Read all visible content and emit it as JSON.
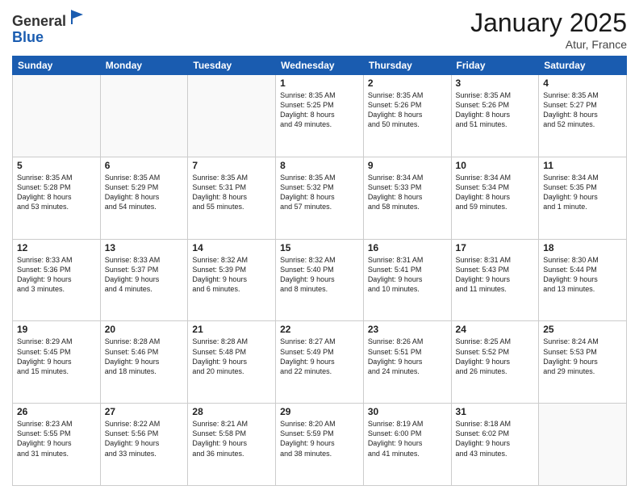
{
  "logo": {
    "general": "General",
    "blue": "Blue"
  },
  "title": "January 2025",
  "location": "Atur, France",
  "days": [
    "Sunday",
    "Monday",
    "Tuesday",
    "Wednesday",
    "Thursday",
    "Friday",
    "Saturday"
  ],
  "weeks": [
    [
      {
        "day": "",
        "content": ""
      },
      {
        "day": "",
        "content": ""
      },
      {
        "day": "",
        "content": ""
      },
      {
        "day": "1",
        "content": "Sunrise: 8:35 AM\nSunset: 5:25 PM\nDaylight: 8 hours\nand 49 minutes."
      },
      {
        "day": "2",
        "content": "Sunrise: 8:35 AM\nSunset: 5:26 PM\nDaylight: 8 hours\nand 50 minutes."
      },
      {
        "day": "3",
        "content": "Sunrise: 8:35 AM\nSunset: 5:26 PM\nDaylight: 8 hours\nand 51 minutes."
      },
      {
        "day": "4",
        "content": "Sunrise: 8:35 AM\nSunset: 5:27 PM\nDaylight: 8 hours\nand 52 minutes."
      }
    ],
    [
      {
        "day": "5",
        "content": "Sunrise: 8:35 AM\nSunset: 5:28 PM\nDaylight: 8 hours\nand 53 minutes."
      },
      {
        "day": "6",
        "content": "Sunrise: 8:35 AM\nSunset: 5:29 PM\nDaylight: 8 hours\nand 54 minutes."
      },
      {
        "day": "7",
        "content": "Sunrise: 8:35 AM\nSunset: 5:31 PM\nDaylight: 8 hours\nand 55 minutes."
      },
      {
        "day": "8",
        "content": "Sunrise: 8:35 AM\nSunset: 5:32 PM\nDaylight: 8 hours\nand 57 minutes."
      },
      {
        "day": "9",
        "content": "Sunrise: 8:34 AM\nSunset: 5:33 PM\nDaylight: 8 hours\nand 58 minutes."
      },
      {
        "day": "10",
        "content": "Sunrise: 8:34 AM\nSunset: 5:34 PM\nDaylight: 8 hours\nand 59 minutes."
      },
      {
        "day": "11",
        "content": "Sunrise: 8:34 AM\nSunset: 5:35 PM\nDaylight: 9 hours\nand 1 minute."
      }
    ],
    [
      {
        "day": "12",
        "content": "Sunrise: 8:33 AM\nSunset: 5:36 PM\nDaylight: 9 hours\nand 3 minutes."
      },
      {
        "day": "13",
        "content": "Sunrise: 8:33 AM\nSunset: 5:37 PM\nDaylight: 9 hours\nand 4 minutes."
      },
      {
        "day": "14",
        "content": "Sunrise: 8:32 AM\nSunset: 5:39 PM\nDaylight: 9 hours\nand 6 minutes."
      },
      {
        "day": "15",
        "content": "Sunrise: 8:32 AM\nSunset: 5:40 PM\nDaylight: 9 hours\nand 8 minutes."
      },
      {
        "day": "16",
        "content": "Sunrise: 8:31 AM\nSunset: 5:41 PM\nDaylight: 9 hours\nand 10 minutes."
      },
      {
        "day": "17",
        "content": "Sunrise: 8:31 AM\nSunset: 5:43 PM\nDaylight: 9 hours\nand 11 minutes."
      },
      {
        "day": "18",
        "content": "Sunrise: 8:30 AM\nSunset: 5:44 PM\nDaylight: 9 hours\nand 13 minutes."
      }
    ],
    [
      {
        "day": "19",
        "content": "Sunrise: 8:29 AM\nSunset: 5:45 PM\nDaylight: 9 hours\nand 15 minutes."
      },
      {
        "day": "20",
        "content": "Sunrise: 8:28 AM\nSunset: 5:46 PM\nDaylight: 9 hours\nand 18 minutes."
      },
      {
        "day": "21",
        "content": "Sunrise: 8:28 AM\nSunset: 5:48 PM\nDaylight: 9 hours\nand 20 minutes."
      },
      {
        "day": "22",
        "content": "Sunrise: 8:27 AM\nSunset: 5:49 PM\nDaylight: 9 hours\nand 22 minutes."
      },
      {
        "day": "23",
        "content": "Sunrise: 8:26 AM\nSunset: 5:51 PM\nDaylight: 9 hours\nand 24 minutes."
      },
      {
        "day": "24",
        "content": "Sunrise: 8:25 AM\nSunset: 5:52 PM\nDaylight: 9 hours\nand 26 minutes."
      },
      {
        "day": "25",
        "content": "Sunrise: 8:24 AM\nSunset: 5:53 PM\nDaylight: 9 hours\nand 29 minutes."
      }
    ],
    [
      {
        "day": "26",
        "content": "Sunrise: 8:23 AM\nSunset: 5:55 PM\nDaylight: 9 hours\nand 31 minutes."
      },
      {
        "day": "27",
        "content": "Sunrise: 8:22 AM\nSunset: 5:56 PM\nDaylight: 9 hours\nand 33 minutes."
      },
      {
        "day": "28",
        "content": "Sunrise: 8:21 AM\nSunset: 5:58 PM\nDaylight: 9 hours\nand 36 minutes."
      },
      {
        "day": "29",
        "content": "Sunrise: 8:20 AM\nSunset: 5:59 PM\nDaylight: 9 hours\nand 38 minutes."
      },
      {
        "day": "30",
        "content": "Sunrise: 8:19 AM\nSunset: 6:00 PM\nDaylight: 9 hours\nand 41 minutes."
      },
      {
        "day": "31",
        "content": "Sunrise: 8:18 AM\nSunset: 6:02 PM\nDaylight: 9 hours\nand 43 minutes."
      },
      {
        "day": "",
        "content": ""
      }
    ]
  ]
}
